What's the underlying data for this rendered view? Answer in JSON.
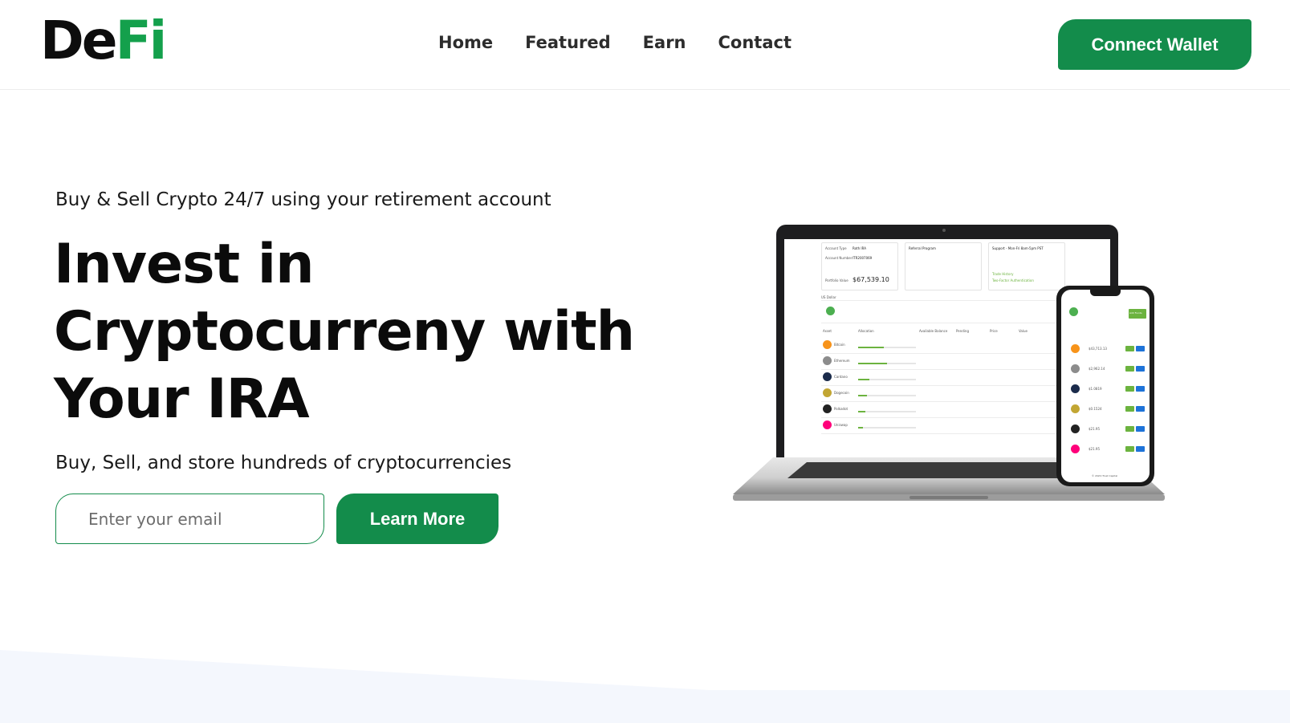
{
  "brand": {
    "part1": "De",
    "part2": "Fi"
  },
  "nav": {
    "items": [
      "Home",
      "Featured",
      "Earn",
      "Contact"
    ]
  },
  "header": {
    "connect_label": "Connect Wallet"
  },
  "hero": {
    "tagline": "Buy & Sell Crypto 24/7 using your retirement account",
    "headline_line1": "Invest in",
    "headline_line2": "Cryptocurreny with",
    "headline_line3": "Your IRA",
    "subline": "Buy, Sell, and store hundreds of cryptocurrencies",
    "email_placeholder": "Enter your email",
    "learn_more_label": "Learn More"
  },
  "device_mock": {
    "account_type_label": "Account Type",
    "account_type_value": "Roth IRA",
    "account_number_label": "Account Number",
    "account_number_value": "ITR2007069",
    "portfolio_label": "Portfolio Value",
    "portfolio_value": "$67,539.10",
    "referral_title": "Referral Program",
    "support_title": "Support - Mon-Fri 8am-5pm PST",
    "trade_history": "Trade History",
    "two_factor": "Two-Factor Authentication",
    "columns": [
      "Asset",
      "Allocation",
      "Available Balance",
      "Pending",
      "Price",
      "Value"
    ],
    "assets": [
      {
        "name": "Bitcoin",
        "color": "#f7931a",
        "symbol": "₿",
        "price": "$43,713.13"
      },
      {
        "name": "Ethereum",
        "color": "#8c8c8c",
        "symbol": "◆",
        "price": "$2,962.14"
      },
      {
        "name": "Cardano",
        "color": "#1b2b4b",
        "symbol": "✺",
        "price": "$1.0819"
      },
      {
        "name": "Dogecoin",
        "color": "#c2a633",
        "symbol": "Ð",
        "price": "$0.1524"
      },
      {
        "name": "Polkadot",
        "color": "#222222",
        "symbol": "P",
        "price": "$21.95"
      },
      {
        "name": "Uniswap",
        "color": "#ff007a",
        "symbol": "🦄",
        "price": "$21.95"
      }
    ],
    "usd_label": "US Dollar",
    "phone_buy": "Buy",
    "phone_sell": "Sell",
    "phone_add_funds": "Add Funds",
    "phone_footer": "© 2020 iTrust Capital"
  },
  "colors": {
    "brand_green": "#138c4b",
    "logo_green": "#14a04c",
    "wave": "#f4f7fd"
  }
}
